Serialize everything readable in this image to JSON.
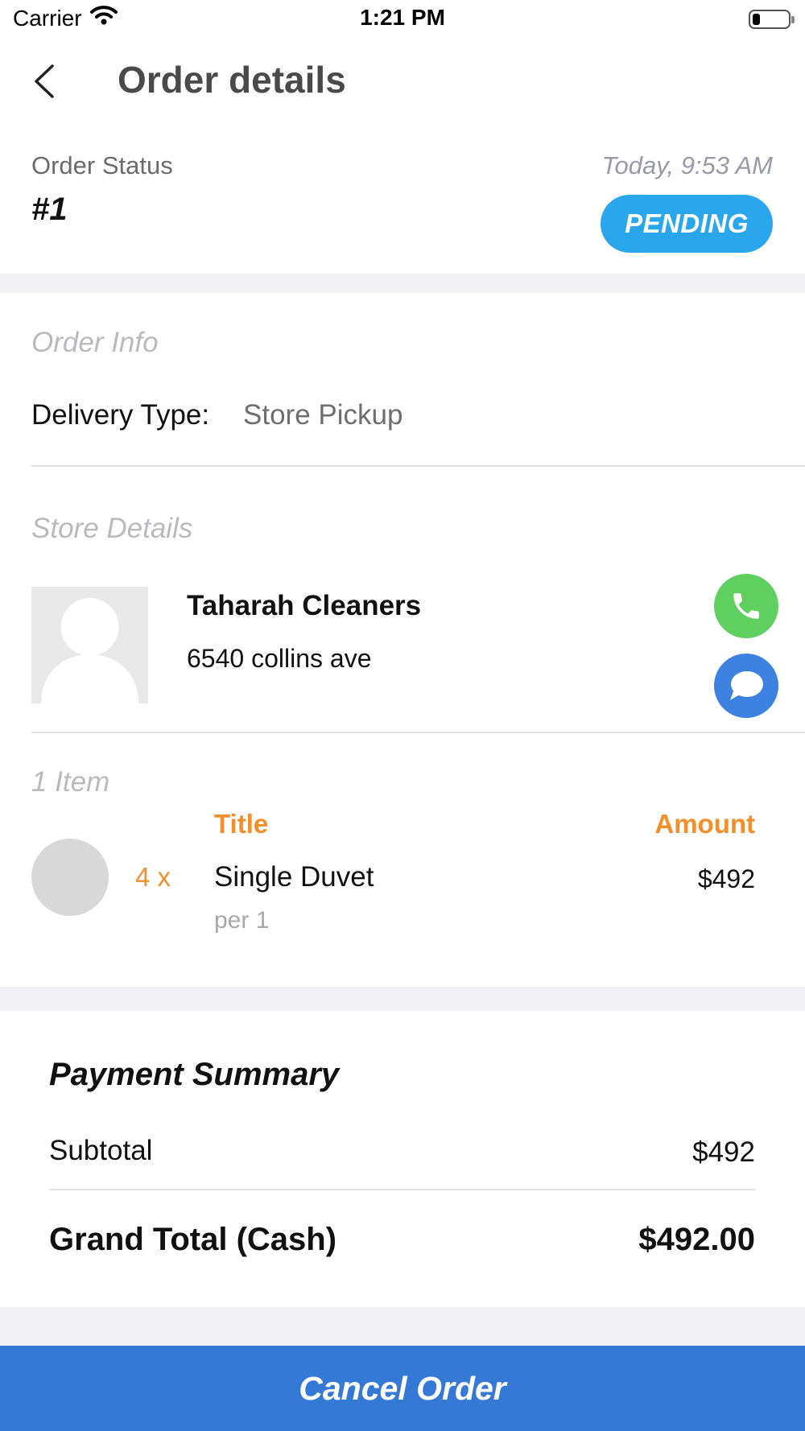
{
  "status_bar": {
    "carrier": "Carrier",
    "time": "1:21 PM",
    "icons": [
      "wifi-icon",
      "battery-icon"
    ]
  },
  "header": {
    "title": "Order details",
    "back_icon": "chevron-left-icon"
  },
  "order_status": {
    "label": "Order Status",
    "number": "#1",
    "timestamp": "Today, 9:53 AM",
    "badge": "PENDING",
    "badge_color": "#29a6ec"
  },
  "order_info": {
    "section_label": "Order Info",
    "delivery_label": "Delivery Type:",
    "delivery_value": "Store Pickup"
  },
  "store": {
    "section_label": "Store Details",
    "name": "Taharah Cleaners",
    "address": "6540 collins ave",
    "call_color": "#5fd060",
    "chat_color": "#3d82e0"
  },
  "items": {
    "count_label": "1  Item",
    "col_title": "Title",
    "col_amount": "Amount",
    "accent_color": "#f28f2b",
    "list": [
      {
        "qty": "4 x",
        "title": "Single Duvet",
        "unit": "per 1",
        "amount": "$492"
      }
    ]
  },
  "payment": {
    "title": "Payment Summary",
    "subtotal_label": "Subtotal",
    "subtotal_value": "$492",
    "grand_label": "Grand Total (Cash)",
    "grand_value": "$492.00"
  },
  "footer": {
    "cancel_label": "Cancel Order",
    "button_color": "#3479d6"
  }
}
